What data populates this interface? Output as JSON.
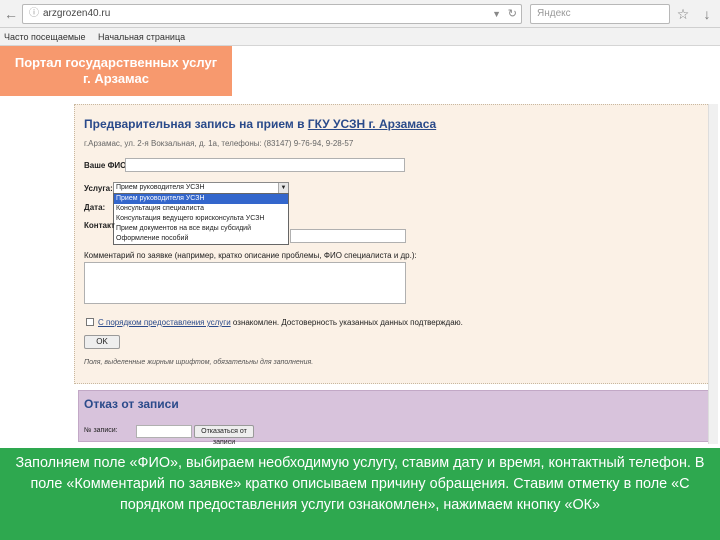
{
  "browser": {
    "url": "arzgrozen40.ru",
    "search_placeholder": "Яндекс",
    "bookmarks": [
      "Часто посещаемые",
      "Начальная страница"
    ]
  },
  "portal": {
    "banner_line1": "Портал государственных услуг",
    "banner_line2": "г. Арзамас"
  },
  "form": {
    "title_prefix": "Предварительная запись на прием в ",
    "title_link": "ГКУ УСЗН г. Арзамаса",
    "address": "г.Арзамас, ул. 2-я Вокзальная, д. 1а, телефоны: (83147) 9-76-94, 9-28-57",
    "fio_label": "Ваше ФИО:",
    "service_label": "Услуга:",
    "service_selected": "Прием руководителя УСЗН",
    "service_options": [
      "Прием руководителя УСЗН",
      "Консультация специалиста",
      "Консультация ведущего юрисконсульта УСЗН",
      "Прием документов на все виды субсидий",
      "Оформление пособий"
    ],
    "date_label": "Дата:",
    "contact_label": "Контакт",
    "comment_label": "Комментарий по заявке (например, кратко описание проблемы, ФИО специалиста и др.):",
    "agree_link": "С порядком предоставления услуги",
    "agree_rest": " ознакомлен. Достоверность указанных данных подтверждаю.",
    "ok_button": "OK",
    "required_note": "Поля, выделенные жирным шрифтом, обязательны для заполнения."
  },
  "cancel": {
    "title": "Отказ от записи",
    "label": "№ записи:",
    "button": "Отказаться от записи"
  },
  "caption": "Заполняем поле «ФИО», выбираем необходимую услугу, ставим дату и время, контактный телефон. В поле «Комментарий по заявке» кратко описываем причину обращения. Ставим отметку в поле «С порядком предоставления услуги ознакомлен», нажимаем кнопку «ОК»",
  "colors": {
    "banner": "#f7996e",
    "form_bg": "#fbf1e6",
    "cancel_bg": "#d8c3dc",
    "caption_bg": "#2ea84f",
    "title_blue": "#2a4a8a"
  }
}
